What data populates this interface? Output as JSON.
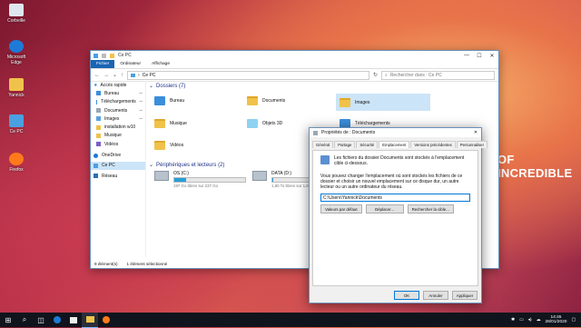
{
  "desktop": {
    "icons": [
      {
        "label": "Corbeille",
        "icon": "recycle-bin-icon",
        "color": "#dfe6ee"
      },
      {
        "label": "Microsoft Edge",
        "icon": "edge-icon",
        "color": "#1d7bd7"
      },
      {
        "label": "Yannick",
        "icon": "user-folder-icon",
        "color": "#f0c24b"
      },
      {
        "label": "Ce PC",
        "icon": "computer-icon",
        "color": "#4aa0e0"
      },
      {
        "label": "Firefox",
        "icon": "firefox-icon",
        "color": "#ff7a1a"
      }
    ],
    "banner_text": "OF INCREDIBLE"
  },
  "explorer": {
    "title": "Ce PC",
    "ribbon_tabs": [
      "Fichier",
      "Ordinateur",
      "Affichage"
    ],
    "address": "Ce PC",
    "search_placeholder": "Rechercher dans : Ce PC",
    "sidebar": [
      {
        "label": "Accès rapide",
        "icon": "star-icon"
      },
      {
        "label": "Bureau",
        "icon": "desktop-folder-icon",
        "pin": "⊸"
      },
      {
        "label": "Téléchargements",
        "icon": "download-folder-icon",
        "pin": "⊸"
      },
      {
        "label": "Documents",
        "icon": "documents-folder-icon",
        "pin": "⊸"
      },
      {
        "label": "Images",
        "icon": "pictures-folder-icon",
        "pin": "⊸"
      },
      {
        "label": "installation w10",
        "icon": "folder-icon"
      },
      {
        "label": "Musique",
        "icon": "music-folder-icon"
      },
      {
        "label": "Vidéos",
        "icon": "videos-folder-icon"
      },
      {
        "label": "OneDrive",
        "icon": "onedrive-icon"
      },
      {
        "label": "Ce PC",
        "icon": "computer-icon"
      },
      {
        "label": "Réseau",
        "icon": "network-icon"
      }
    ],
    "folders_header": "Dossiers (7)",
    "folders": [
      {
        "label": "Bureau"
      },
      {
        "label": "Documents"
      },
      {
        "label": "Images"
      },
      {
        "label": "Musique"
      },
      {
        "label": "Objets 3D"
      },
      {
        "label": "Téléchargements"
      },
      {
        "label": "Vidéos"
      }
    ],
    "drives_header": "Périphériques et lecteurs (2)",
    "drives": [
      {
        "label": "OS (C:)",
        "info": "197 Go libres sur 237 Go",
        "used": 0.17
      },
      {
        "label": "DATA (D:)",
        "info": "1,80 To libres sur 1,81 To",
        "used": 0.01
      }
    ],
    "status": {
      "count": "9 élément(s)",
      "selection": "1 élément sélectionné"
    }
  },
  "dialog": {
    "title": "Propriétés de : Documents",
    "tabs": [
      "Général",
      "Partage",
      "Sécurité",
      "Emplacement",
      "Versions précédentes",
      "Personnaliser"
    ],
    "description": "Les fichiers du dossier Documents sont stockés à l'emplacement cible ci-dessous.",
    "instructions": "Vous pouvez changer l'emplacement où sont stockés les fichiers de ce dossier et choisir un nouvel emplacement sur ce disque dur, un autre lecteur ou un autre ordinateur du réseau.",
    "path": "C:\\Users\\Yannick\\Documents",
    "buttons": [
      "Valeurs par défaut",
      "Déplacer...",
      "Rechercher la cible..."
    ],
    "footer": [
      "OK",
      "Annuler",
      "Appliquer"
    ]
  },
  "taskbar": {
    "time": "14:45",
    "date": "28/01/2020"
  }
}
